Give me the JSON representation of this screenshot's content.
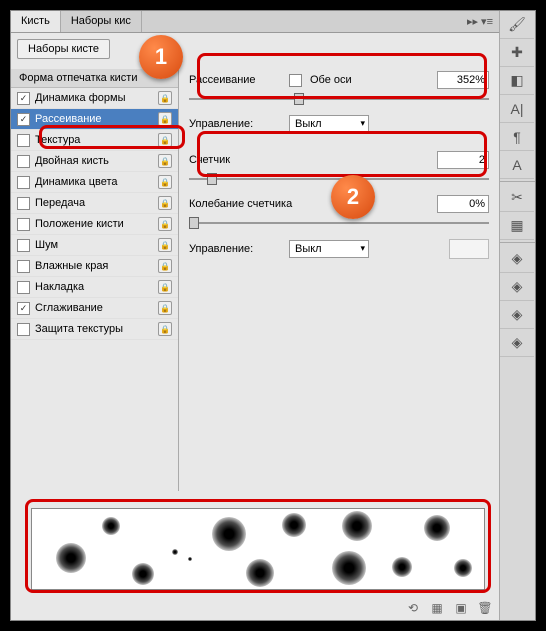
{
  "tabs": {
    "brush": "Кисть",
    "presets": "Наборы кис"
  },
  "presets_btn": "Наборы кисте",
  "section_header": "Форма отпечатка кисти",
  "options": [
    {
      "label": "Динамика формы",
      "checked": true,
      "selected": false
    },
    {
      "label": "Рассеивание",
      "checked": true,
      "selected": true
    },
    {
      "label": "Текстура",
      "checked": false,
      "selected": false
    },
    {
      "label": "Двойная кисть",
      "checked": false,
      "selected": false
    },
    {
      "label": "Динамика цвета",
      "checked": false,
      "selected": false
    },
    {
      "label": "Передача",
      "checked": false,
      "selected": false
    },
    {
      "label": "Положение кисти",
      "checked": false,
      "selected": false
    },
    {
      "label": "Шум",
      "checked": false,
      "selected": false
    },
    {
      "label": "Влажные края",
      "checked": false,
      "selected": false
    },
    {
      "label": "Накладка",
      "checked": false,
      "selected": false
    },
    {
      "label": "Сглаживание",
      "checked": true,
      "selected": false
    },
    {
      "label": "Защита текстуры",
      "checked": false,
      "selected": false
    }
  ],
  "scatter": {
    "label": "Рассеивание",
    "both_axes": "Обе оси",
    "value": "352%"
  },
  "control1": {
    "label": "Управление:",
    "value": "Выкл"
  },
  "counter": {
    "label": "Счетчик",
    "value": "2"
  },
  "jitter": {
    "label": "Колебание счетчика",
    "value": "0%"
  },
  "control2": {
    "label": "Управление:",
    "value": "Выкл"
  },
  "badges": {
    "one": "1",
    "two": "2"
  }
}
